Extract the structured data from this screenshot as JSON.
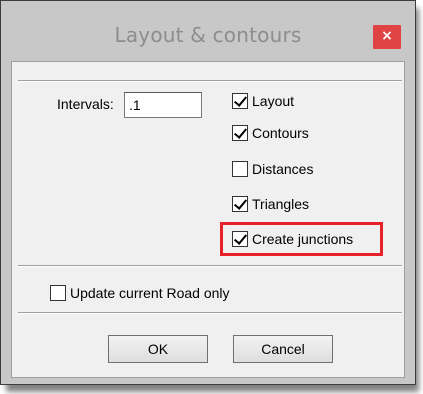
{
  "window": {
    "title": "Layout & contours",
    "close_glyph": "×"
  },
  "intervals": {
    "label": "Intervals:",
    "value": ".1"
  },
  "options": [
    {
      "label": "Layout",
      "checked": true
    },
    {
      "label": "Contours",
      "checked": true
    },
    {
      "label": "Distances",
      "checked": false
    },
    {
      "label": "Triangles",
      "checked": true
    },
    {
      "label": "Create junctions",
      "checked": true,
      "highlighted": true
    }
  ],
  "update_current_road": {
    "label": "Update current Road only",
    "checked": false
  },
  "buttons": {
    "ok": "OK",
    "cancel": "Cancel"
  },
  "colors": {
    "highlight": "#e8202a",
    "close_button": "#e04343",
    "title_text": "#8d8d8d"
  }
}
